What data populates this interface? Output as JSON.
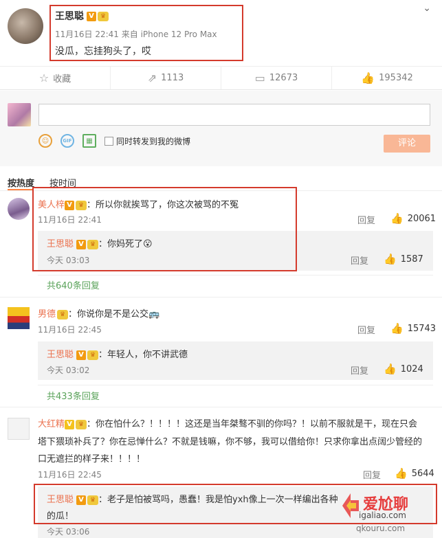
{
  "post": {
    "author": "王思聪",
    "verified_badge": "V",
    "member_badge": "👑",
    "meta": "11月16日 22:41 来自 iPhone 12 Pro Max",
    "text": "没瓜，忘挂狗头了，哎",
    "menu_glyph": "⌄"
  },
  "actions": [
    {
      "icon": "star-icon",
      "glyph": "☆",
      "label": "收藏"
    },
    {
      "icon": "share-icon",
      "glyph": "⇗",
      "label": "1113"
    },
    {
      "icon": "comment-icon",
      "glyph": "▭",
      "label": "12673"
    },
    {
      "icon": "like-icon",
      "glyph": "👍",
      "label": "195342"
    }
  ],
  "compose": {
    "placeholder": "",
    "smile_glyph": "☺",
    "gif_label": "GIF",
    "picture_glyph": "▦",
    "repost_label": "同时转发到我的微博",
    "submit_label": "评论"
  },
  "sort": {
    "hot": "按热度",
    "time": "按时间"
  },
  "comments": [
    {
      "name": "美人梓",
      "text": "：所以你就挨骂了，你这次被骂的不冤",
      "time": "11月16日 22:41",
      "reply": "回复",
      "likes": "20061",
      "sub": {
        "name": "王思聪",
        "text": "：你妈死了😮",
        "time": "今天 03:03",
        "reply": "回复",
        "likes": "1587"
      },
      "more": "共640条回复"
    },
    {
      "name": "男德",
      "text": "：你说你是不是公交🚌",
      "time": "11月16日 22:45",
      "reply": "回复",
      "likes": "15743",
      "sub": {
        "name": "王思聪",
        "text": "：年轻人，你不讲武德",
        "time": "今天 03:02",
        "reply": "回复",
        "likes": "1024"
      },
      "more": "共433条回复"
    },
    {
      "name": "大红精",
      "text_lines": [
        "：你在怕什么？！！！！这还是当年桀骜不驯的你吗？！以前不服就是干，现在只会",
        "塔下猥琐补兵了？你在忌惮什么？不就是钱嘛，你不够，我可以借给你！只求你拿出点阔少管经的",
        "口无遮拦的样子来！！！！"
      ],
      "time": "11月16日 22:45",
      "reply": "回复",
      "likes": "5644",
      "sub": {
        "name": "王思聪",
        "text_lines": [
          "：老子是怕被骂吗，愚蠢！我是怕yxh像上一次一样编出各种",
          "的瓜！"
        ],
        "time": "今天 03:06"
      }
    }
  ],
  "watermark": {
    "main": "爱尬聊",
    "sub": "igaliao.com",
    "bottom": "qkouru.com"
  },
  "colors": {
    "accent_red": "#d43a2c",
    "nick": "#eb7350",
    "link_green": "#5aa35a",
    "submit": "#f9b796"
  }
}
